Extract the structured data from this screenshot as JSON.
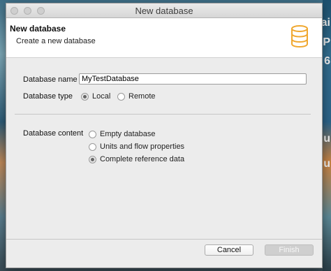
{
  "window": {
    "title": "New database"
  },
  "header": {
    "title": "New database",
    "subtitle": "Create a new database",
    "icon": "database-icon"
  },
  "form": {
    "name_label": "Database name",
    "name_value": "MyTestDatabase",
    "type_label": "Database type",
    "type_options": [
      "Local",
      "Remote"
    ],
    "type_selected": "Local",
    "content_label": "Database content",
    "content_options": [
      "Empty database",
      "Units and flow properties",
      "Complete reference data"
    ],
    "content_selected": "Complete reference data"
  },
  "buttons": {
    "cancel": "Cancel",
    "finish": "Finish"
  },
  "background_text": [
    "ai",
    "P",
    "6",
    "u",
    "u"
  ],
  "colors": {
    "icon_accent": "#f0a830"
  }
}
